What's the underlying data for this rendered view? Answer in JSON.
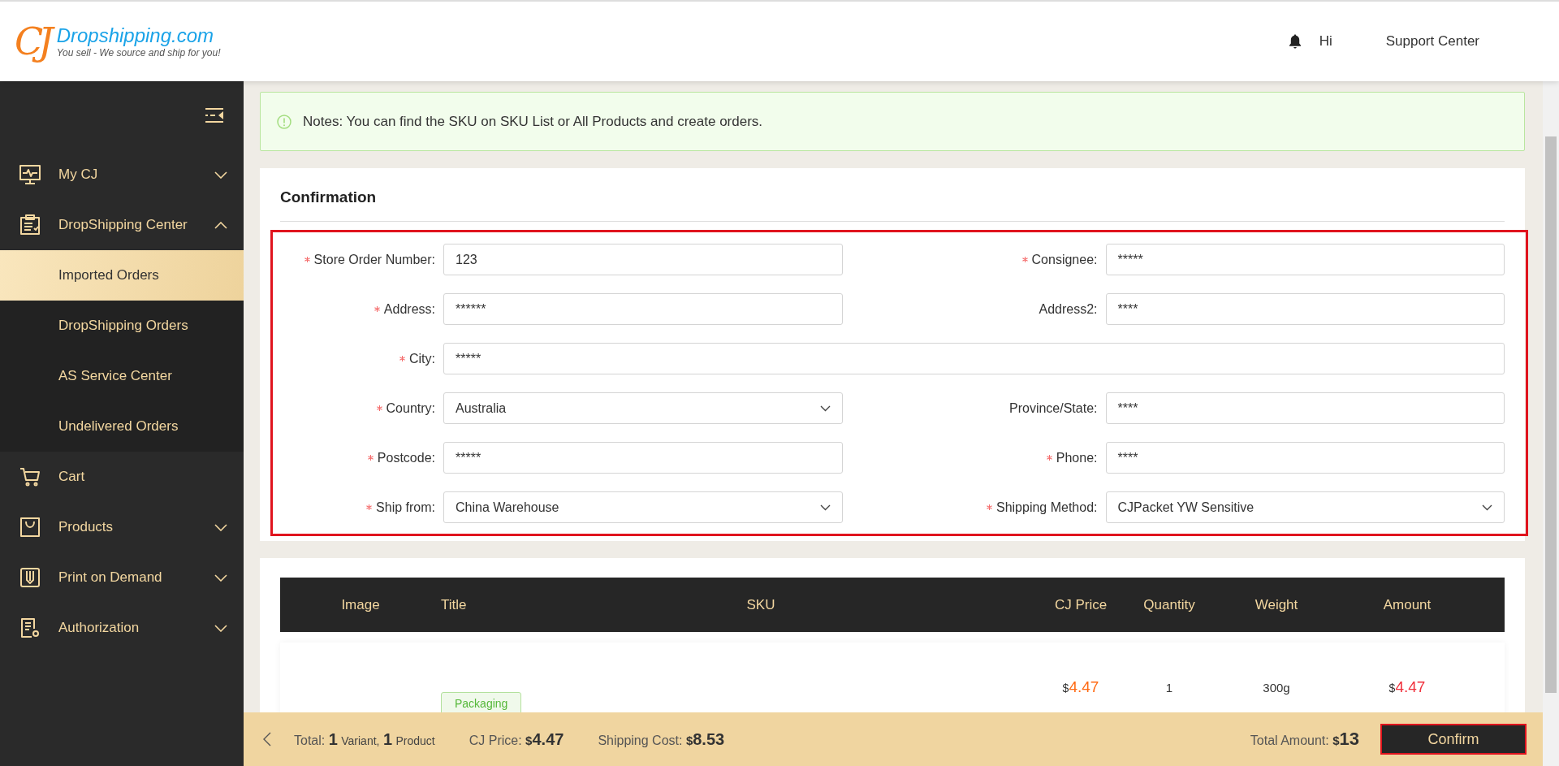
{
  "header": {
    "logo": {
      "mark": "CJ",
      "brand": "Dropshipping.com",
      "tagline": "You sell - We source and ship for you!"
    },
    "greeting": "Hi",
    "support": "Support Center"
  },
  "sidebar": {
    "items": [
      {
        "kind": "group",
        "label": "My CJ",
        "expanded": false
      },
      {
        "kind": "group",
        "label": "DropShipping Center",
        "expanded": true,
        "children": [
          {
            "label": "Imported Orders",
            "selected": true
          },
          {
            "label": "DropShipping Orders",
            "selected": false
          },
          {
            "label": "AS Service Center",
            "selected": false
          },
          {
            "label": "Undelivered Orders",
            "selected": false
          }
        ]
      },
      {
        "kind": "link",
        "label": "Cart"
      },
      {
        "kind": "group",
        "label": "Products",
        "expanded": false
      },
      {
        "kind": "group",
        "label": "Print on Demand",
        "expanded": false
      },
      {
        "kind": "group",
        "label": "Authorization",
        "expanded": false
      }
    ]
  },
  "notice": "Notes: You can find the SKU on SKU List or All Products and create orders.",
  "confirmation": {
    "title": "Confirmation",
    "rows": [
      [
        {
          "label": "Store Order Number:",
          "required": true,
          "kind": "text",
          "value": "123"
        },
        {
          "label": "Consignee:",
          "required": true,
          "kind": "text",
          "value": "*****"
        }
      ],
      [
        {
          "label": "Address:",
          "required": true,
          "kind": "text",
          "value": "******"
        },
        {
          "label": "Address2:",
          "required": false,
          "kind": "text",
          "value": "****"
        }
      ],
      [
        {
          "label": "City:",
          "required": true,
          "kind": "text",
          "value": "*****"
        }
      ],
      [
        {
          "label": "Country:",
          "required": true,
          "kind": "select",
          "value": "Australia"
        },
        {
          "label": "Province/State:",
          "required": false,
          "kind": "text",
          "value": "****"
        }
      ],
      [
        {
          "label": "Postcode:",
          "required": true,
          "kind": "text",
          "value": "*****"
        },
        {
          "label": "Phone:",
          "required": true,
          "kind": "text",
          "value": "****"
        }
      ],
      [
        {
          "label": "Ship from:",
          "required": true,
          "kind": "select",
          "value": "China Warehouse"
        },
        {
          "label": "Shipping Method:",
          "required": true,
          "kind": "select",
          "value": "CJPacket YW Sensitive"
        }
      ]
    ]
  },
  "table": {
    "columns": [
      "Image",
      "Title",
      "SKU",
      "CJ Price",
      "Quantity",
      "Weight",
      "Amount"
    ],
    "rows": [
      {
        "tag": "Packaging",
        "cj_price": {
          "currency": "$",
          "amount": "4.47"
        },
        "quantity": "1",
        "weight": "300g",
        "amount": {
          "currency": "$",
          "amount": "4.47"
        }
      }
    ]
  },
  "footer": {
    "total": {
      "label": "Total:",
      "variant_count": "1",
      "variant_word": "Variant,",
      "product_count": "1",
      "product_word": "Product"
    },
    "cj_price": {
      "label": "CJ Price:",
      "currency": "$",
      "amount": "4.47"
    },
    "shipping": {
      "label": "Shipping Cost:",
      "currency": "$",
      "amount": "8.53"
    },
    "total_amount": {
      "label": "Total Amount:",
      "currency": "$",
      "amount": "13"
    },
    "button": "Confirm"
  }
}
